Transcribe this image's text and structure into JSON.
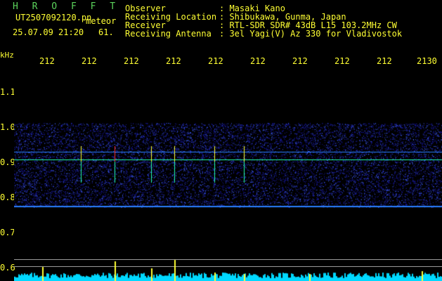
{
  "header": {
    "brand": "H R O F F T",
    "file_id": "UT2507092120.pn",
    "tag": "meteor",
    "date_time": "25.07.09 21:20",
    "count": "61.",
    "fields": [
      {
        "label": "Observer",
        "value": ": Masaki Kano"
      },
      {
        "label": "Receiving Location",
        "value": ": Shibukawa, Gunma, Japan"
      },
      {
        "label": "Receiver",
        "value": ": RTL-SDR SDR# 43dB L15 103.2MHz CW"
      },
      {
        "label": "Receiving Antenna",
        "value": ": 3el Yagi(V) Az 330 for Vladivostok"
      }
    ]
  },
  "axis": {
    "y_unit": "kHz",
    "y_ticks": [
      "1.1",
      "1.0",
      "0.9",
      "0.8",
      "0.7",
      "0.6"
    ],
    "x_ticks": [
      "212",
      "212",
      "212",
      "212",
      "212",
      "212",
      "212",
      "212",
      "212",
      "2130"
    ]
  },
  "colors": {
    "text": "#ffff33",
    "brand": "#5cd35c",
    "noise_low": "#1818a0",
    "noise_high": "#4060ff",
    "band": "#2a7fff",
    "echo_hot": "#ff3030",
    "echo_mid": "#ffff33",
    "bar_base": "#00d8ff"
  }
}
